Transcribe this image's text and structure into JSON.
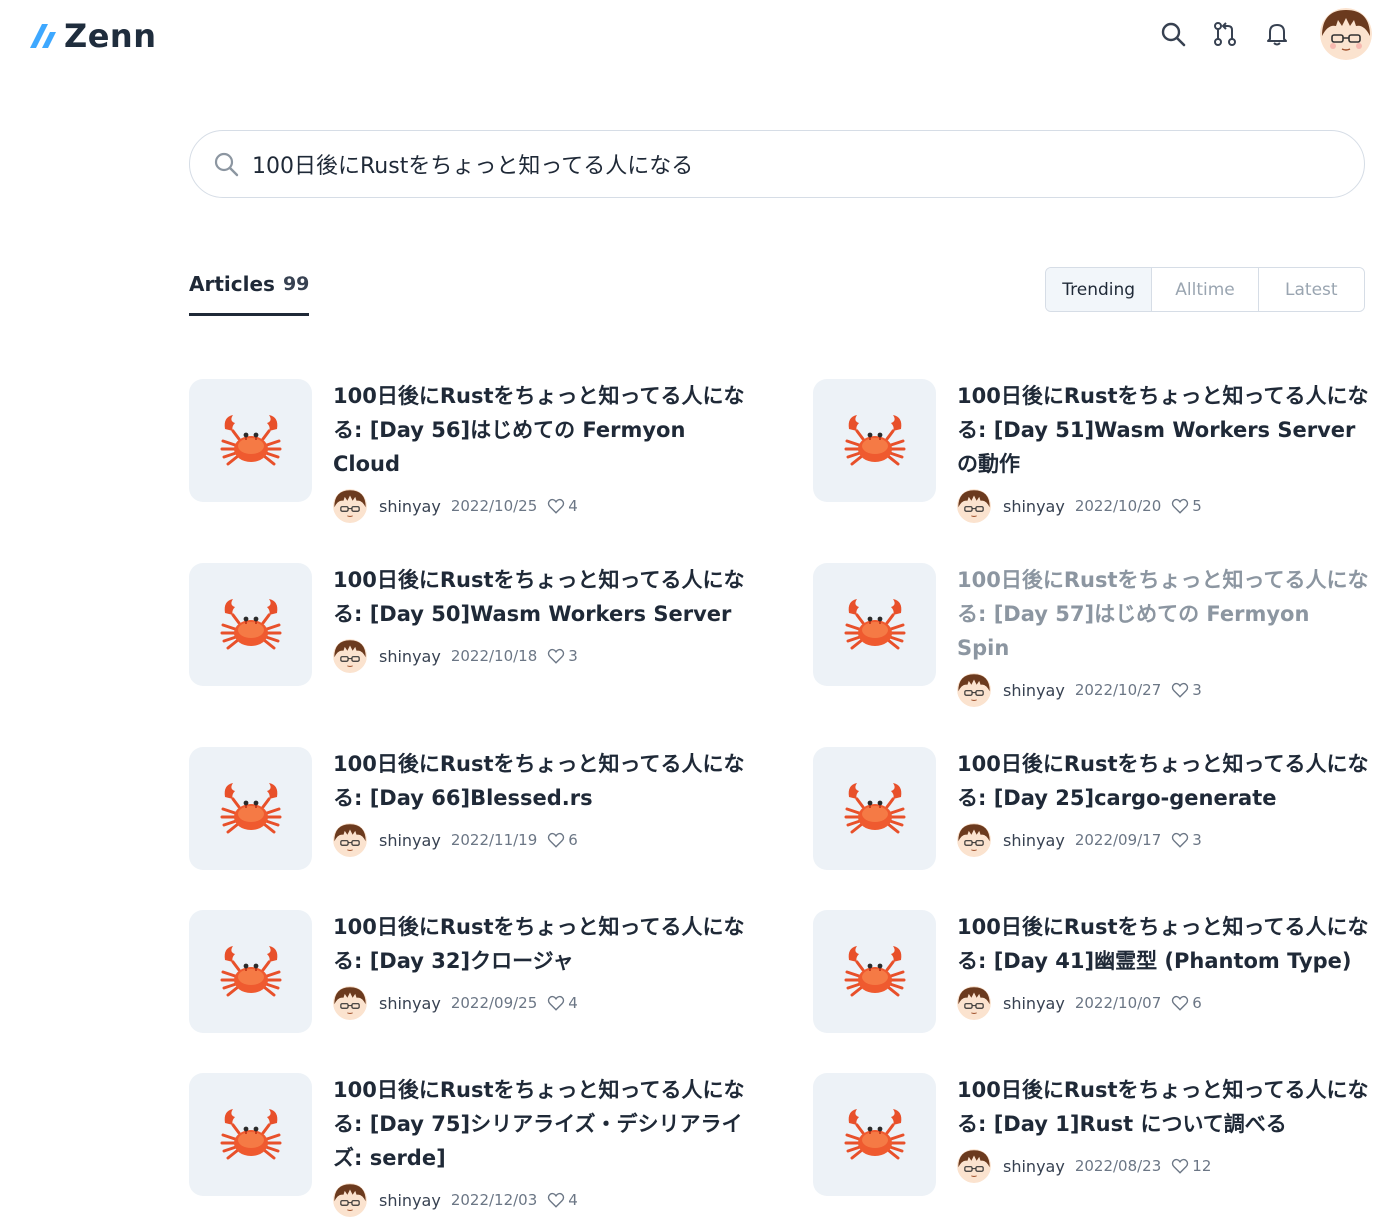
{
  "header": {
    "logo_text": "Zenn",
    "icons": [
      "search-icon",
      "pull-request-icon",
      "bell-icon"
    ],
    "accent": "#3ea8ff"
  },
  "search": {
    "query": "100日後にRustをちょっと知ってる人になる"
  },
  "tabs": {
    "articles_label": "Articles",
    "articles_count": "99"
  },
  "sort": {
    "options": [
      "Trending",
      "Alltime",
      "Latest"
    ],
    "selected": "Trending"
  },
  "articles": [
    {
      "title": "100日後にRustをちょっと知ってる人になる: [Day 56]はじめての Fermyon Cloud",
      "author": "shinyay",
      "date": "2022/10/25",
      "likes": "4"
    },
    {
      "title": "100日後にRustをちょっと知ってる人になる: [Day 51]Wasm Workers Server の動作",
      "author": "shinyay",
      "date": "2022/10/20",
      "likes": "5"
    },
    {
      "title": "100日後にRustをちょっと知ってる人になる: [Day 50]Wasm Workers Server",
      "author": "shinyay",
      "date": "2022/10/18",
      "likes": "3"
    },
    {
      "title": "100日後にRustをちょっと知ってる人になる: [Day 57]はじめての Fermyon Spin",
      "author": "shinyay",
      "date": "2022/10/27",
      "likes": "3"
    },
    {
      "title": "100日後にRustをちょっと知ってる人になる: [Day 66]Blessed.rs",
      "author": "shinyay",
      "date": "2022/11/19",
      "likes": "6"
    },
    {
      "title": "100日後にRustをちょっと知ってる人になる: [Day 25]cargo-generate",
      "author": "shinyay",
      "date": "2022/09/17",
      "likes": "3"
    },
    {
      "title": "100日後にRustをちょっと知ってる人になる: [Day 32]クロージャ",
      "author": "shinyay",
      "date": "2022/09/25",
      "likes": "4"
    },
    {
      "title": "100日後にRustをちょっと知ってる人になる: [Day 41]幽霊型 (Phantom Type)",
      "author": "shinyay",
      "date": "2022/10/07",
      "likes": "6"
    },
    {
      "title": "100日後にRustをちょっと知ってる人になる: [Day 75]シリアライズ・デシリアライズ: serde]",
      "author": "shinyay",
      "date": "2022/12/03",
      "likes": "4"
    },
    {
      "title": "100日後にRustをちょっと知ってる人になる: [Day 1]Rust について調べる",
      "author": "shinyay",
      "date": "2022/08/23",
      "likes": "12"
    }
  ]
}
